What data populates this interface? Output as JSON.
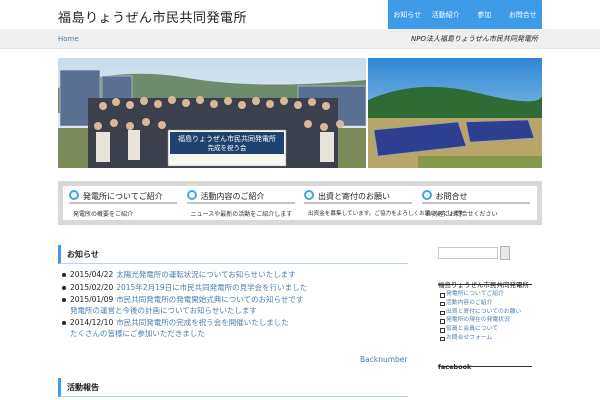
{
  "site": {
    "title": "福島りょうぜん市民共同発電所",
    "tagline": "NPO法人福島りょうぜん市民共同発電所"
  },
  "nav": {
    "items": [
      "お知らせ",
      "活動紹介",
      "参加",
      "お問合せ"
    ]
  },
  "breadcrumb": {
    "home": "Home"
  },
  "hero": {
    "banner_line1": "福島りょうぜん市民共同発電所",
    "banner_line2": "完成を祝う会"
  },
  "features": [
    {
      "title": "発電所についてご紹介",
      "desc": "発電所の概要をご紹介"
    },
    {
      "title": "活動内容のご紹介",
      "desc": "ニュースや最新の活動をご紹介します"
    },
    {
      "title": "出資と寄付のお願い",
      "desc": "出資金を募集しています。ご協力をよろしくお願いいたします"
    },
    {
      "title": "お問合せ",
      "desc": "お気軽にお問合せください"
    }
  ],
  "news": {
    "heading": "お知らせ",
    "items": [
      {
        "date": "2015/04/22",
        "lines": [
          "太陽光発電所の運転状況についてお知らせいたします"
        ]
      },
      {
        "date": "2015/02/20",
        "lines": [
          "2015年2月19日に市民共同発電所の見学会を行いました"
        ]
      },
      {
        "date": "2015/01/09",
        "lines": [
          "市民共同発電所の発電開始式典についてのお知らせです",
          "発電所の運営と今後の計画についてお知らせいたします"
        ]
      },
      {
        "date": "2014/12/10",
        "lines": [
          "市民共同発電所の完成を祝う会を開催いたしました",
          "たくさんの皆様にご参加いただきました"
        ]
      }
    ],
    "backnumber": "Backnumber"
  },
  "section2": {
    "heading": "活動報告"
  },
  "sidebar": {
    "search_placeholder": "",
    "menu_heading": "福島りょうぜん市民共同発電所",
    "menu_items": [
      "発電所についてご紹介",
      "活動内容のご紹介",
      "出資と寄付についてのお願い",
      "発電所の現在の発電状況",
      "役員と会員について",
      "お問合せフォーム"
    ],
    "facebook_heading": "facebook"
  },
  "colors": {
    "accent": "#3d9be9",
    "link": "#4a7db1"
  }
}
